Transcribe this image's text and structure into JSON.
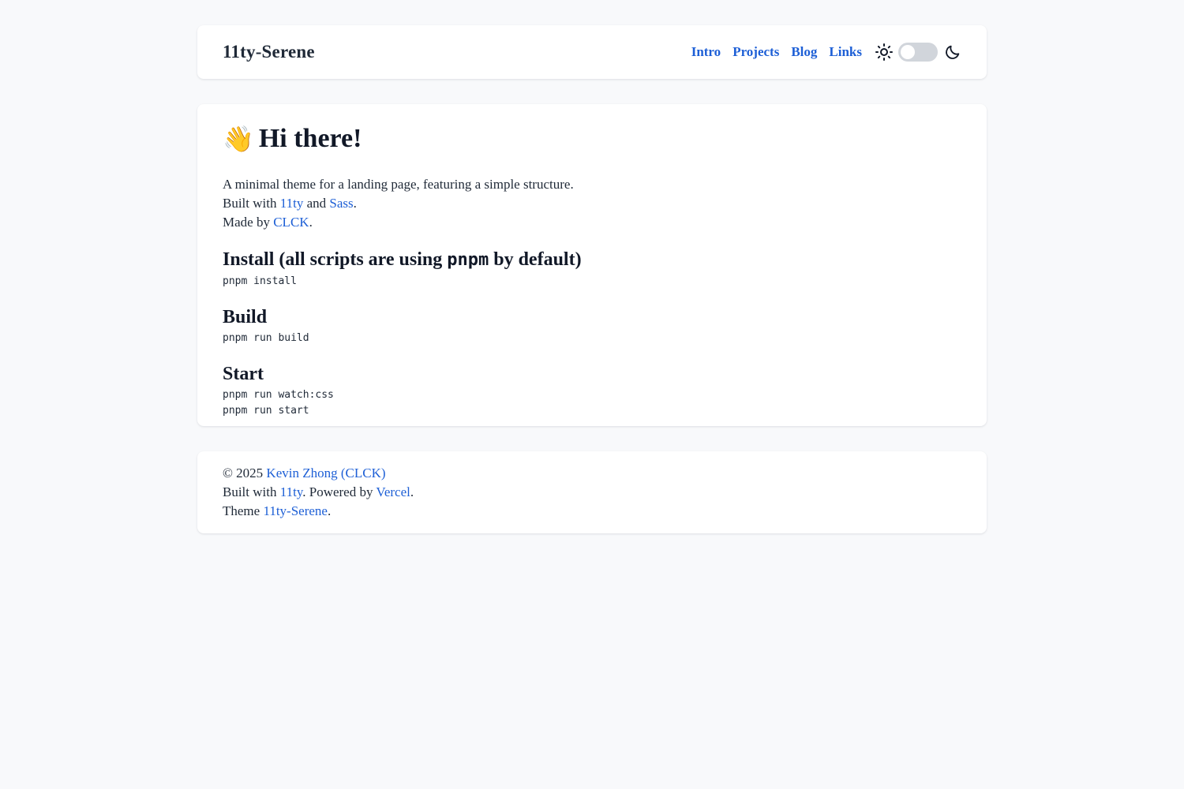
{
  "header": {
    "brand": "11ty-Serene",
    "nav": [
      "Intro",
      "Projects",
      "Blog",
      "Links"
    ],
    "theme_toggle": {
      "mode": "light"
    }
  },
  "main": {
    "emoji": "👋",
    "title": "Hi there!",
    "intro": {
      "line1": "A minimal theme for a landing page, featuring a simple structure.",
      "built_prefix": "Built with ",
      "built_link1": "11ty",
      "built_mid": " and ",
      "built_link2": "Sass",
      "built_suffix": ".",
      "made_prefix": "Made by ",
      "made_link": "CLCK",
      "made_suffix": "."
    },
    "install": {
      "heading_prefix": "Install (all scripts are using ",
      "heading_code": "pnpm",
      "heading_suffix": " by default)",
      "command": "pnpm install"
    },
    "build": {
      "heading": "Build",
      "command": "pnpm run build"
    },
    "start": {
      "heading": "Start",
      "command1": "pnpm run watch:css",
      "command2": "pnpm run start"
    }
  },
  "footer": {
    "copy_prefix": "© 2025 ",
    "author_link": "Kevin Zhong (CLCK)",
    "built_prefix": "Built with ",
    "built_link": "11ty",
    "powered_prefix": ". Powered by ",
    "powered_link": "Vercel",
    "powered_suffix": ".",
    "theme_prefix": "Theme ",
    "theme_link": "11ty-Serene",
    "theme_suffix": "."
  },
  "colors": {
    "background": "#f8f9fb",
    "card": "#ffffff",
    "link": "#1d5fd6",
    "text": "#1f2937",
    "toggle_track": "#d1d5db"
  }
}
